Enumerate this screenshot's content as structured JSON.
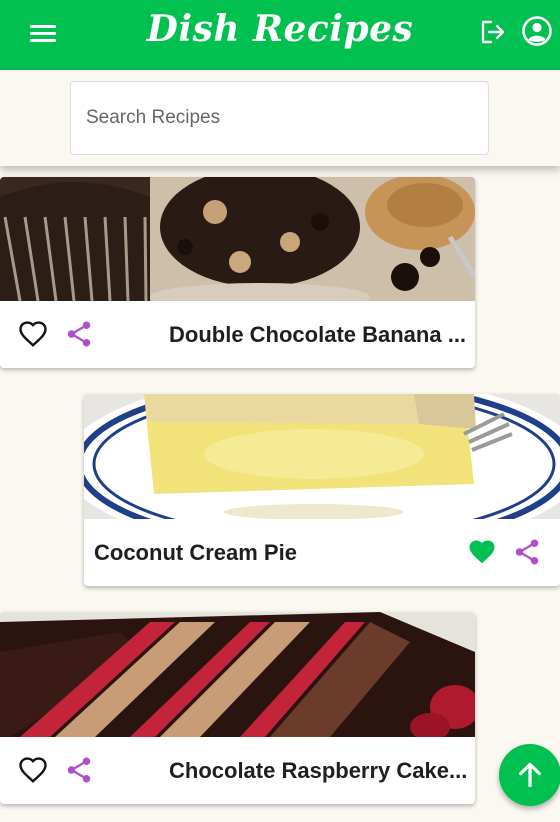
{
  "app": {
    "title": "Dish Recipes"
  },
  "appbar": {
    "menu_icon": "hamburger-menu-icon",
    "logout_icon": "logout-icon",
    "account_icon": "account-circle-icon",
    "background_color": "#00c04f"
  },
  "search": {
    "placeholder": "Search Recipes",
    "value": ""
  },
  "recipes": [
    {
      "title": "Double Chocolate Banana ...",
      "favorited": false,
      "image": "chocolate-muffins-photo"
    },
    {
      "title": "Coconut Cream Pie",
      "favorited": true,
      "image": "coconut-cream-pie-photo"
    },
    {
      "title": "Chocolate Raspberry Cake...",
      "favorited": false,
      "image": "chocolate-raspberry-cake-photo"
    }
  ],
  "colors": {
    "accent": "#00c04f",
    "share": "#b04fc9",
    "heart_outline": "#111111"
  },
  "fab": {
    "icon": "arrow-up-icon"
  }
}
